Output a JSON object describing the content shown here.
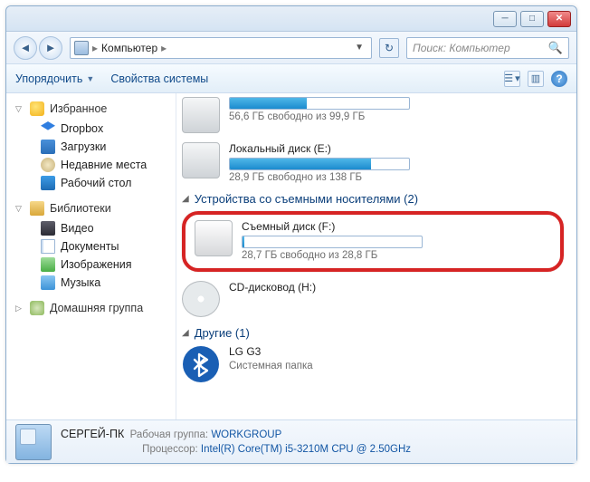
{
  "breadcrumb": {
    "root": "Компьютер"
  },
  "search": {
    "placeholder": "Поиск: Компьютер"
  },
  "toolbar": {
    "organize": "Упорядочить",
    "properties": "Свойства системы"
  },
  "sidebar": {
    "favorites": {
      "label": "Избранное",
      "items": [
        {
          "label": "Dropbox"
        },
        {
          "label": "Загрузки"
        },
        {
          "label": "Недавние места"
        },
        {
          "label": "Рабочий стол"
        }
      ]
    },
    "libraries": {
      "label": "Библиотеки",
      "items": [
        {
          "label": "Видео"
        },
        {
          "label": "Документы"
        },
        {
          "label": "Изображения"
        },
        {
          "label": "Музыка"
        }
      ]
    },
    "homegroup": {
      "label": "Домашняя группа"
    }
  },
  "content": {
    "top_drive": {
      "free_text": "56,6 ГБ свободно из 99,9 ГБ",
      "fill_pct": 43
    },
    "drive_e": {
      "name": "Локальный диск (E:)",
      "free_text": "28,9 ГБ свободно из 138 ГБ",
      "fill_pct": 79
    },
    "group_removable": {
      "label": "Устройства со съемными носителями (2)"
    },
    "drive_f": {
      "name": "Съемный диск (F:)",
      "free_text": "28,7 ГБ свободно из 28,8 ГБ",
      "fill_pct": 1
    },
    "drive_cd": {
      "name": "CD-дисковод (H:)"
    },
    "group_other": {
      "label": "Другие (1)"
    },
    "bt": {
      "name": "LG G3",
      "desc": "Системная папка"
    }
  },
  "status": {
    "pc_name": "СЕРГЕЙ-ПК",
    "workgroup_label": "Рабочая группа:",
    "workgroup_value": "WORKGROUP",
    "cpu_label": "Процессор:",
    "cpu_value": "Intel(R) Core(TM) i5-3210M CPU @ 2.50GHz"
  }
}
